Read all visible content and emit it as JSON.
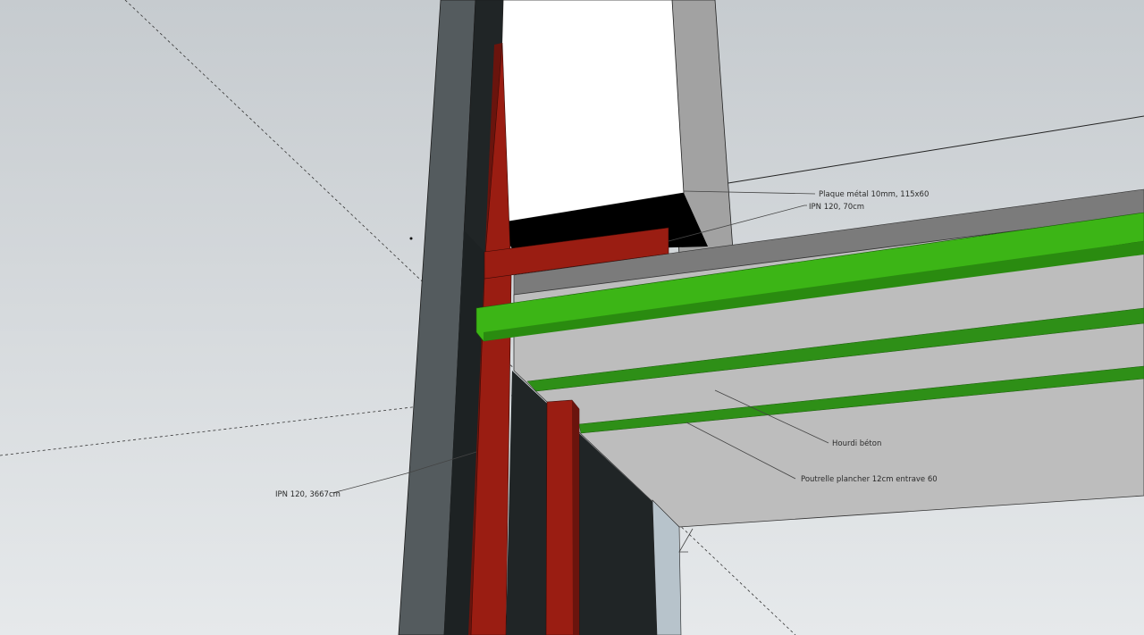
{
  "colors": {
    "sky_top": "#c6cbcf",
    "sky_bottom": "#e6e9eb",
    "steel_red": "#9a1d12",
    "joist_green": "#3cb516",
    "slab_grey": "#bdbdbd",
    "column_grey": "#545b5e",
    "dark": "#202526",
    "white_block": "#ffffff"
  },
  "annotations": {
    "plate": "Plaque métal 10mm, 115x60",
    "ipn_short": "IPN 120, 70cm",
    "hourdi": "Hourdi béton",
    "poutrelle": "Poutrelle plancher 12cm entrave 60",
    "ipn_long": "IPN 120, 3667cm"
  }
}
